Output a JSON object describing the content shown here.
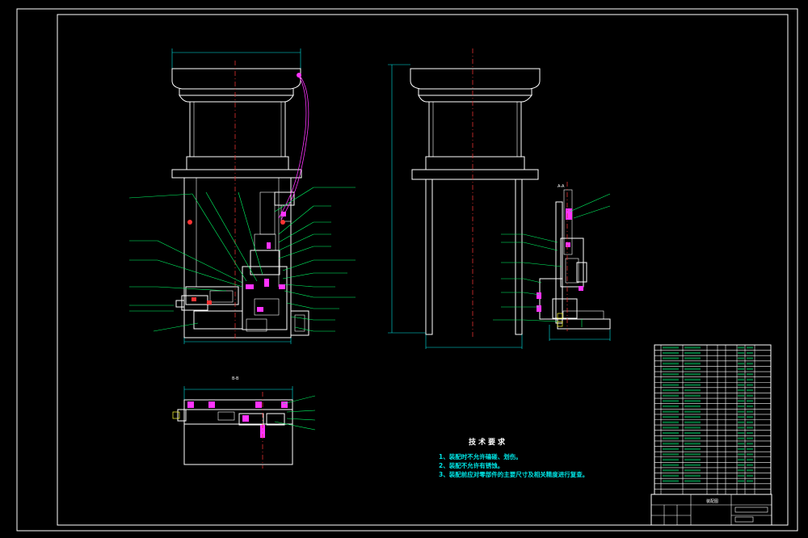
{
  "section_labels": {
    "bb": "B-B",
    "aa": "A-A"
  },
  "technical_requirements": {
    "title": "技术要求",
    "items": [
      "1、装配时不允许磕碰、划伤。",
      "2、装配不允许有锈蚀。",
      "3、装配前应对零部件的主要尺寸及相关精度进行复查。"
    ]
  },
  "title_block": {
    "drawing_name": "装配图",
    "company": "",
    "sheet": ""
  },
  "colors": {
    "border": "#ffffff",
    "outline": "#ffffff",
    "dimension": "#00e5e5",
    "leader": "#00ff66",
    "centerline": "#e03030",
    "cable": "#ff33ff",
    "background": "#000000"
  }
}
